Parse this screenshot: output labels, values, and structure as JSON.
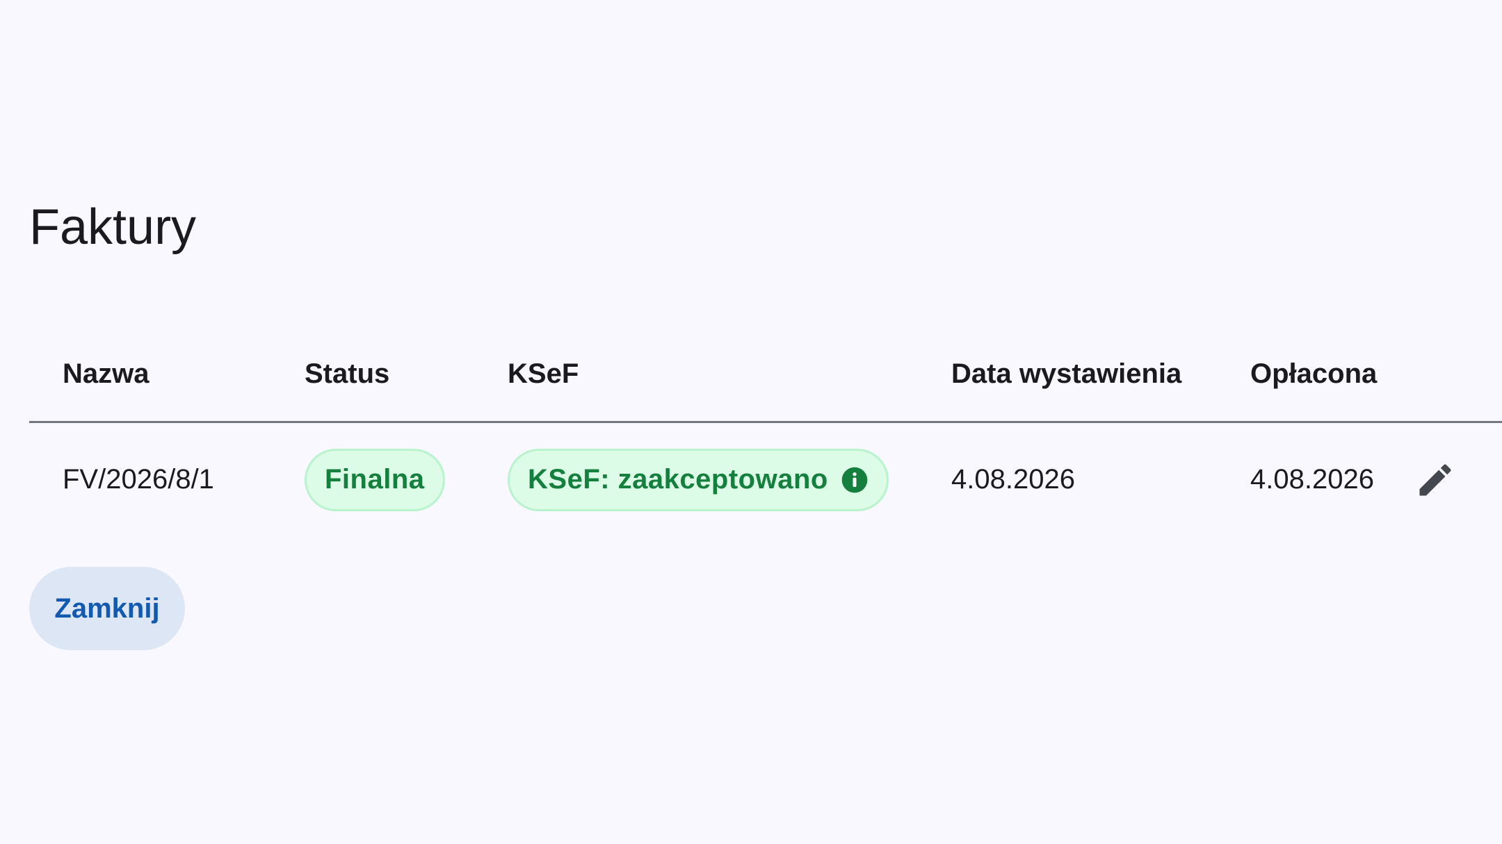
{
  "page": {
    "title": "Faktury"
  },
  "table": {
    "headers": [
      "Nazwa",
      "Status",
      "KSeF",
      "Data wystawienia",
      "Opłacona"
    ],
    "rows": [
      {
        "name": "FV/2026/8/1",
        "status": "Finalna",
        "ksef": "KSeF: zaakceptowano",
        "issue_date": "4.08.2026",
        "paid_date": "4.08.2026",
        "ksef_icon": "info-icon",
        "action_icon": "pencil-icon"
      }
    ]
  },
  "actions": {
    "close_label": "Zamknij"
  },
  "colors": {
    "background": "#f9f8fe",
    "chip_bg": "#dcfce7",
    "chip_text": "#15803d",
    "button_bg": "#dce6f5",
    "button_text": "#1259b0",
    "divider": "#74777f"
  }
}
